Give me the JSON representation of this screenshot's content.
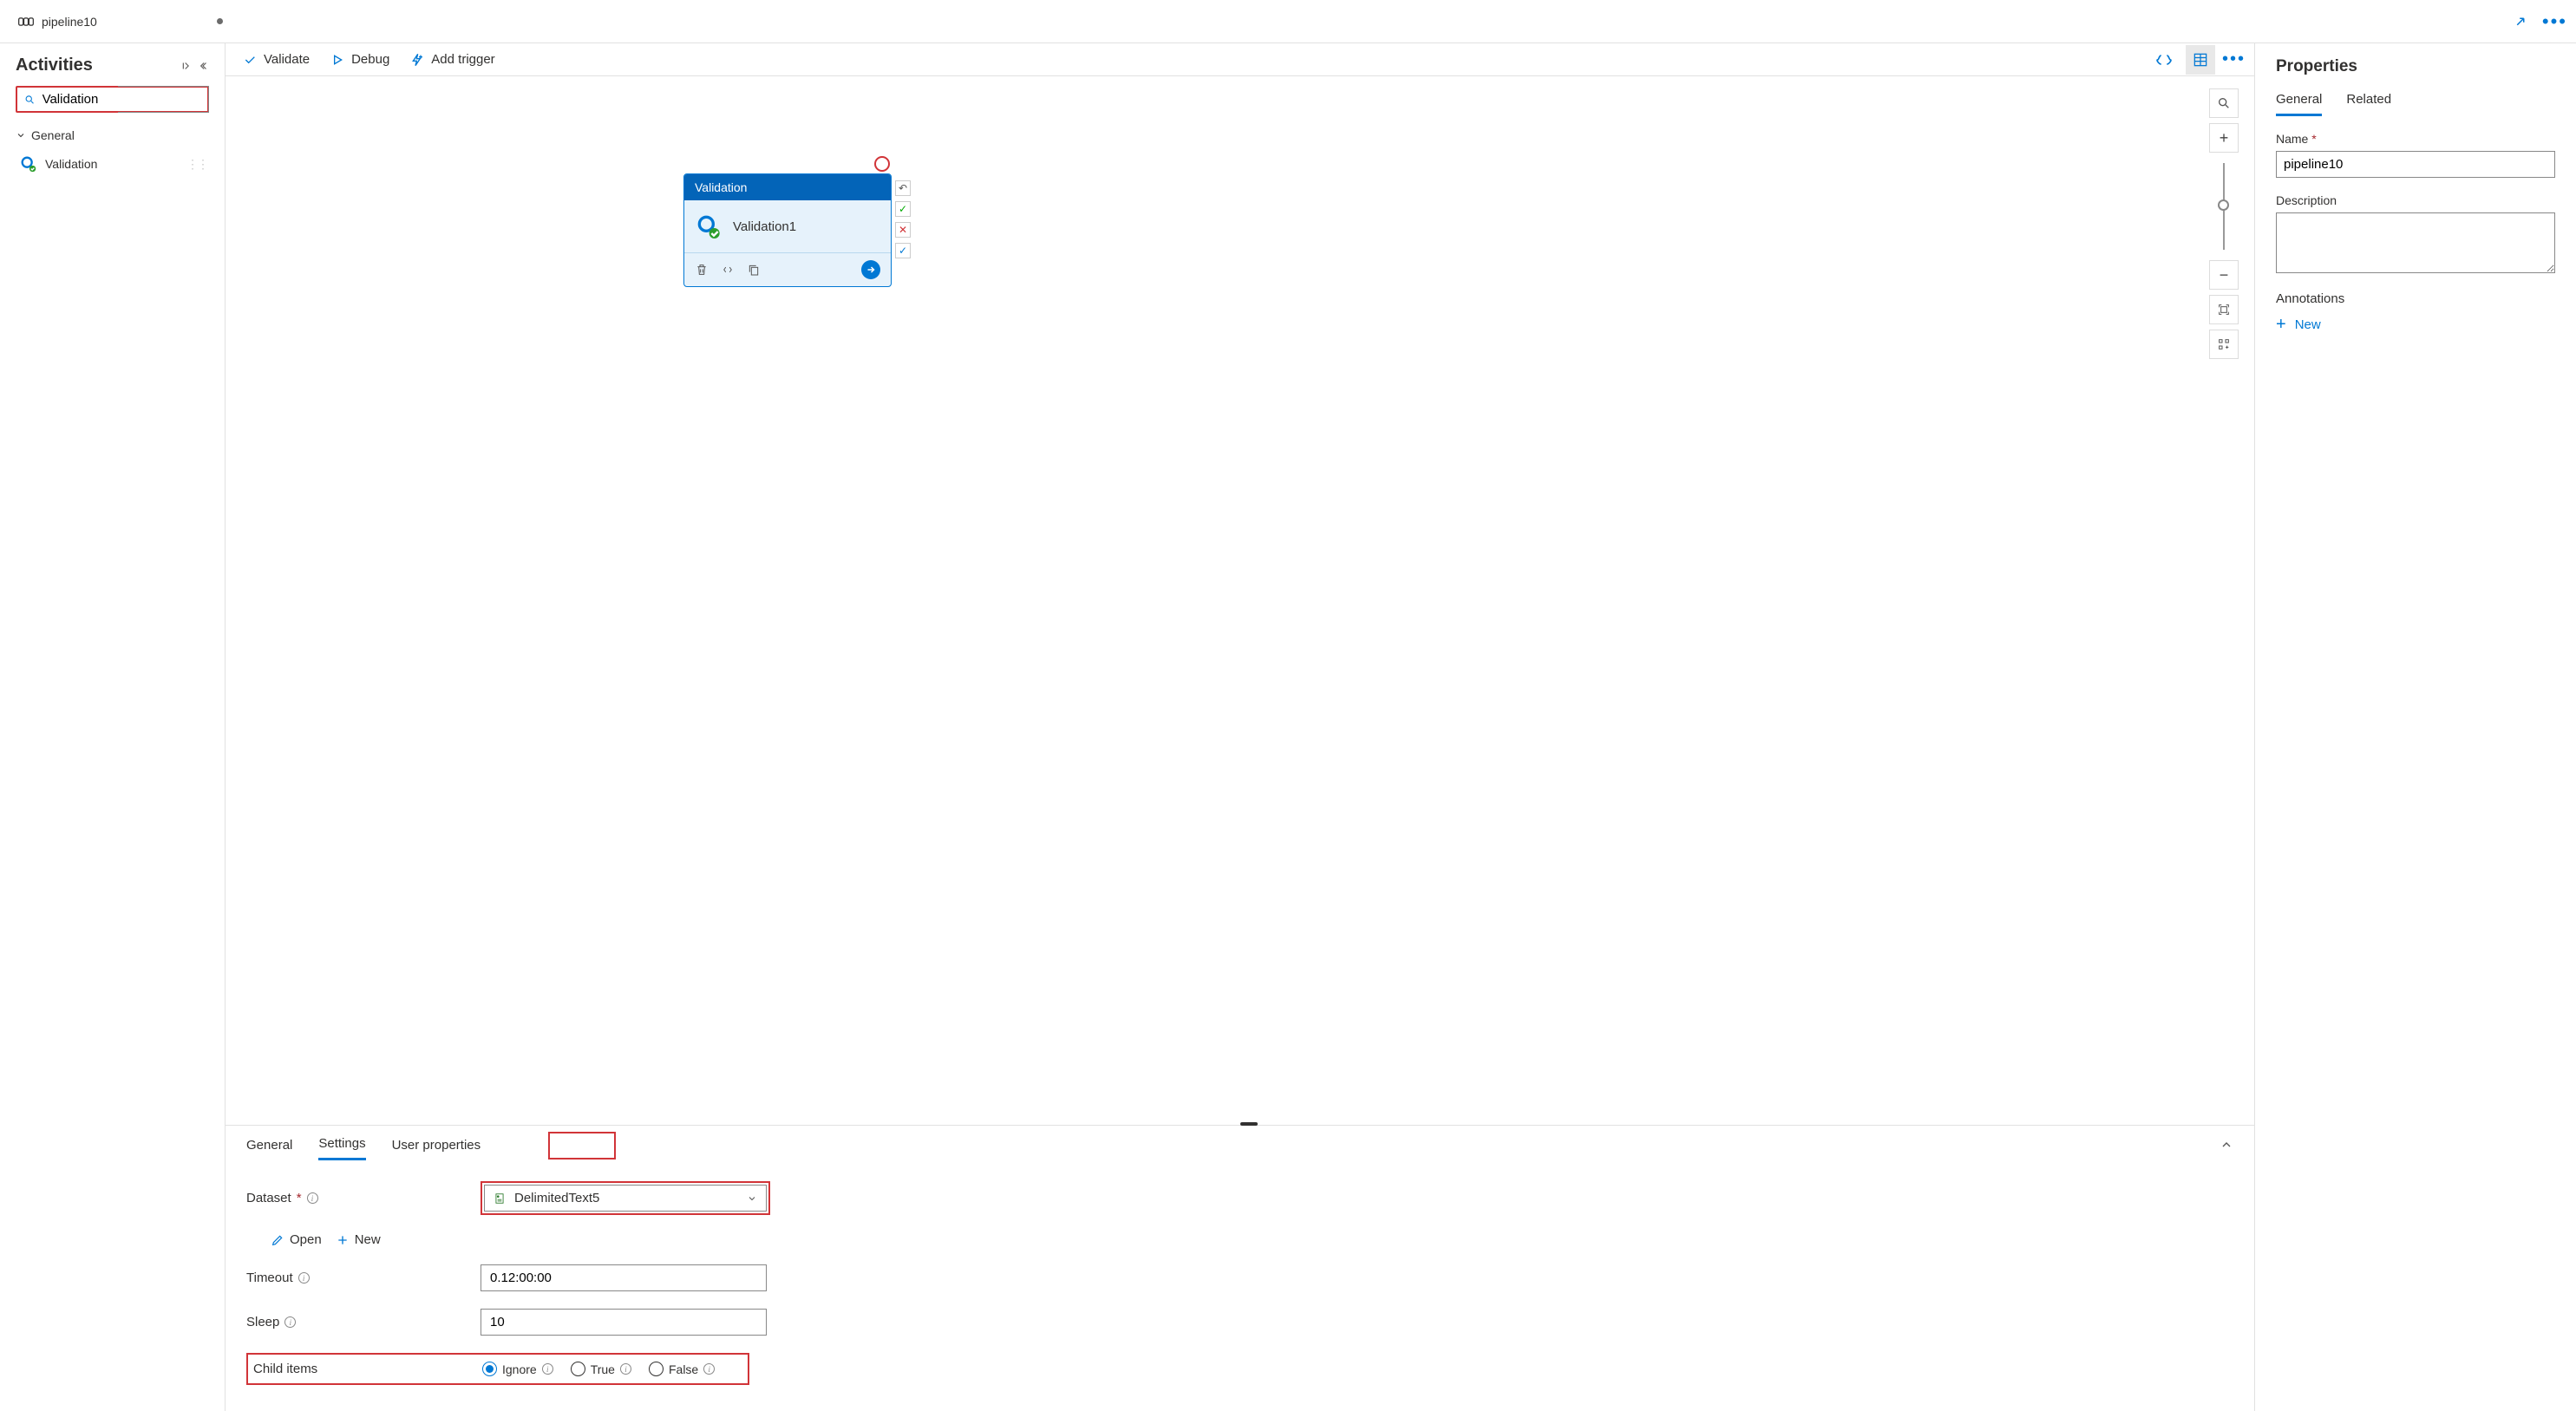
{
  "tab": {
    "title": "pipeline10"
  },
  "sidebar": {
    "title": "Activities",
    "search_value": "Validation",
    "section": "General",
    "item": "Validation"
  },
  "toolbar": {
    "validate": "Validate",
    "debug": "Debug",
    "add_trigger": "Add trigger"
  },
  "node": {
    "header": "Validation",
    "name": "Validation1"
  },
  "panel": {
    "tabs": {
      "general": "General",
      "settings": "Settings",
      "user_props": "User properties"
    },
    "dataset_label": "Dataset",
    "dataset_value": "DelimitedText5",
    "open": "Open",
    "new": "New",
    "timeout_label": "Timeout",
    "timeout_value": "0.12:00:00",
    "sleep_label": "Sleep",
    "sleep_value": "10",
    "childitems_label": "Child items",
    "radios": {
      "ignore": "Ignore",
      "true": "True",
      "false": "False"
    }
  },
  "properties": {
    "title": "Properties",
    "tabs": {
      "general": "General",
      "related": "Related"
    },
    "name_label": "Name",
    "name_value": "pipeline10",
    "desc_label": "Description",
    "annotations_label": "Annotations",
    "new_label": "New"
  }
}
